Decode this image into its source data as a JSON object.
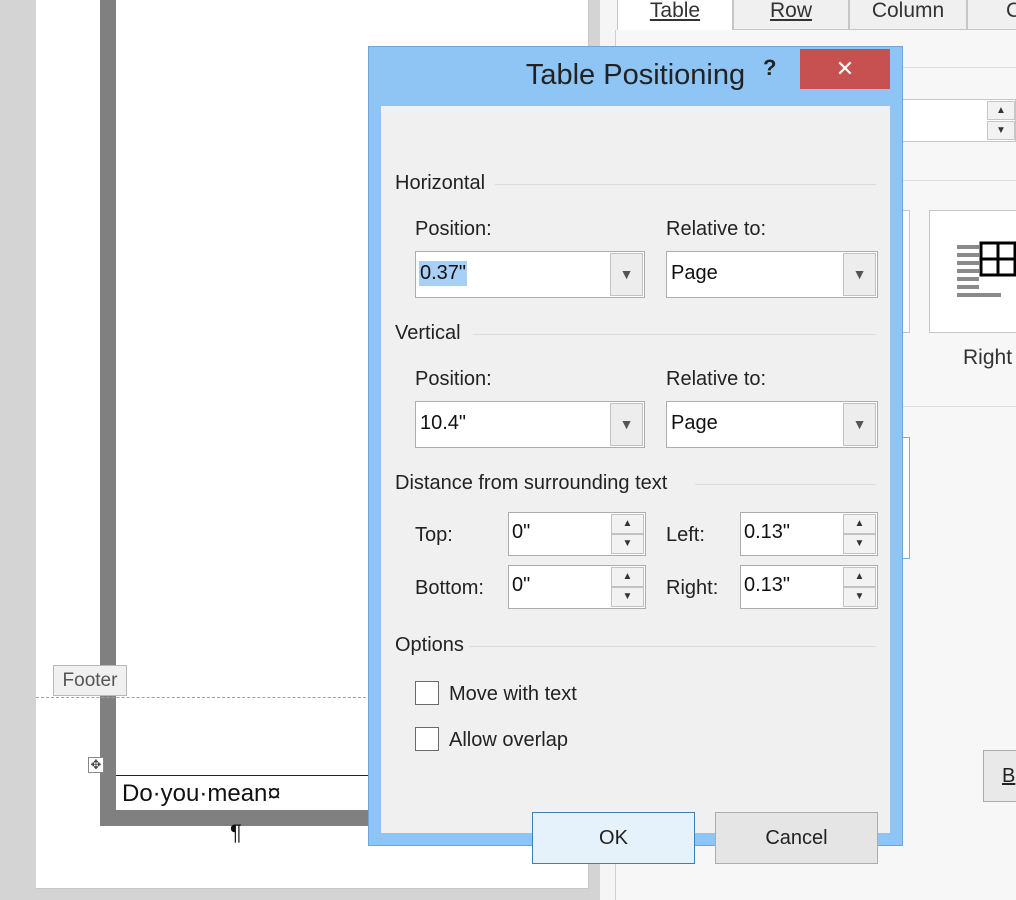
{
  "document": {
    "footer_label": "Footer",
    "body_text": "Do·you·mean¤",
    "paragraph_mark": "¶",
    "move_handle_glyph": "✥"
  },
  "side_panel": {
    "tabs": [
      {
        "label": "Table"
      },
      {
        "label": "Row"
      },
      {
        "label": "Column"
      },
      {
        "label": "C"
      }
    ],
    "alignment_label": "Right",
    "button_partial_label": "B"
  },
  "dialog": {
    "title": "Table Positioning",
    "help_label": "?",
    "close_glyph": "✕",
    "horizontal": {
      "group_label": "Horizontal",
      "position_label": "Position:",
      "position_value": "0.37\"",
      "relative_label": "Relative to:",
      "relative_value": "Page"
    },
    "vertical": {
      "group_label": "Vertical",
      "position_label": "Position:",
      "position_value": "10.4\"",
      "relative_label": "Relative to:",
      "relative_value": "Page"
    },
    "distance": {
      "group_label": "Distance from surrounding text",
      "top_label": "Top:",
      "top_value": "0\"",
      "bottom_label": "Bottom:",
      "bottom_value": "0\"",
      "left_label": "Left:",
      "left_value": "0.13\"",
      "right_label": "Right:",
      "right_value": "0.13\""
    },
    "options": {
      "group_label": "Options",
      "move_with_text_label": "Move with text",
      "move_with_text_checked": false,
      "allow_overlap_label": "Allow overlap",
      "allow_overlap_checked": false
    },
    "ok_label": "OK",
    "cancel_label": "Cancel"
  },
  "icons": {
    "dropdown": "chevron-down-icon",
    "spin_up": "triangle-up-icon",
    "spin_down": "triangle-down-icon",
    "close": "close-icon",
    "move": "move-icon",
    "table_align_right": "table-align-right-icon"
  },
  "colors": {
    "dialog_frame": "#8ec5f4",
    "close_button": "#c75050",
    "selection": "#a8cff5",
    "default_button_border": "#3c7fb1"
  }
}
